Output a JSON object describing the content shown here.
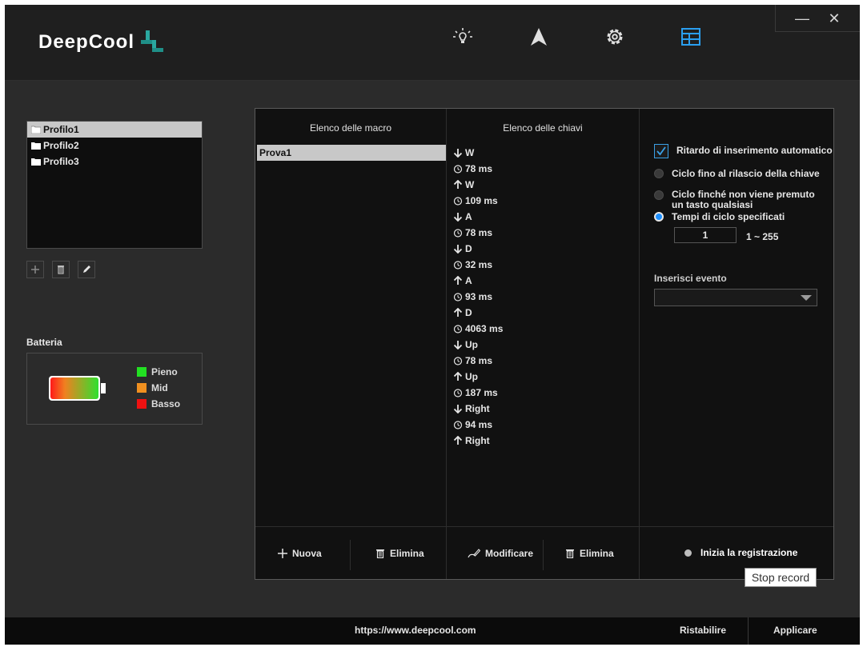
{
  "brand": {
    "logo_text": "DeepCool"
  },
  "nav": {
    "tabs": [
      {
        "icon": "lighting-icon"
      },
      {
        "icon": "pointer-icon"
      },
      {
        "icon": "gear-icon"
      },
      {
        "icon": "macro-grid-icon",
        "active": true
      }
    ]
  },
  "window": {
    "minimize": "—",
    "close": "✕"
  },
  "colors": {
    "accent": "#1e90ff",
    "full": "#22e022",
    "mid": "#f09020",
    "low": "#ee1111",
    "selected_row": "#c8c8c8"
  },
  "profiles": {
    "items": [
      {
        "label": "Profilo1",
        "selected": true
      },
      {
        "label": "Profilo2"
      },
      {
        "label": "Profilo3"
      }
    ]
  },
  "battery": {
    "title": "Batteria",
    "legend": [
      {
        "label": "Pieno"
      },
      {
        "label": "Mid"
      },
      {
        "label": "Basso"
      }
    ]
  },
  "macros": {
    "header": "Elenco delle macro",
    "items": [
      {
        "label": "Prova1",
        "selected": true
      }
    ],
    "new_label": "Nuova",
    "delete_label": "Elimina"
  },
  "keys": {
    "header": "Elenco delle chiavi",
    "items": [
      {
        "type": "down",
        "text": "W"
      },
      {
        "type": "delay",
        "text": "78 ms"
      },
      {
        "type": "up",
        "text": "W"
      },
      {
        "type": "delay",
        "text": "109 ms"
      },
      {
        "type": "down",
        "text": "A"
      },
      {
        "type": "delay",
        "text": "78 ms"
      },
      {
        "type": "down",
        "text": "D"
      },
      {
        "type": "delay",
        "text": "32 ms"
      },
      {
        "type": "up",
        "text": "A"
      },
      {
        "type": "delay",
        "text": "93 ms"
      },
      {
        "type": "up",
        "text": "D"
      },
      {
        "type": "delay",
        "text": "4063 ms"
      },
      {
        "type": "down",
        "text": "Up"
      },
      {
        "type": "delay",
        "text": "78 ms"
      },
      {
        "type": "up",
        "text": "Up"
      },
      {
        "type": "delay",
        "text": "187 ms"
      },
      {
        "type": "down",
        "text": "Right"
      },
      {
        "type": "delay",
        "text": "94 ms"
      },
      {
        "type": "up",
        "text": "Right"
      }
    ],
    "edit_label": "Modificare",
    "delete_label": "Elimina"
  },
  "settings": {
    "auto_delay_label": "Ritardo di inserimento automatico",
    "auto_delay_checked": true,
    "loop_release_label": "Ciclo fino al rilascio della chiave",
    "loop_anykey_label": "Ciclo finché non viene premuto un tasto qualsiasi",
    "loop_count_label": "Tempi di ciclo specificati",
    "loop_count_value": "1",
    "loop_range": "1 ~ 255",
    "insert_event_label": "Inserisci evento",
    "insert_event_value": "",
    "record_label": "Inizia la registrazione"
  },
  "tooltip": "Stop record",
  "footer": {
    "url": "https://www.deepcool.com",
    "reset_label": "Ristabilire",
    "apply_label": "Applicare"
  }
}
